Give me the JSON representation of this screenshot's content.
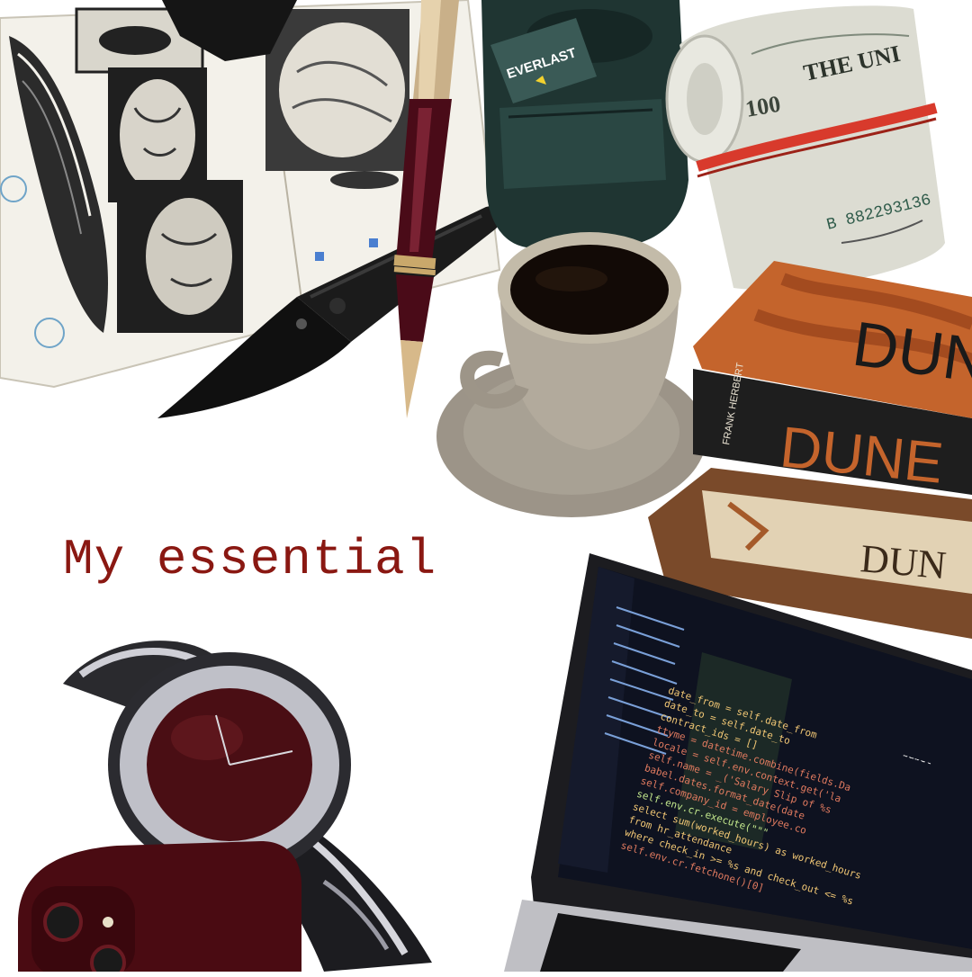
{
  "caption": "My essential",
  "items": {
    "sketchbook": "sketchbook-icon",
    "pen": "fountain-pen-icon",
    "knife": "folding-knife-icon",
    "gloves": "boxing-gloves-icon",
    "money": "cash-roll-icon",
    "coffee": "coffee-cup-icon",
    "books": "books-icon",
    "watch": "watch-icon",
    "phone": "phone-icon",
    "laptop": "laptop-icon"
  },
  "labels": {
    "glove_tag": "EVERLAST",
    "bill_denomination": "100",
    "bill_header": "THE UNI",
    "bill_serial": "B 882293136",
    "book_author": "FRANK HERBERT",
    "book_title_1": "DUNE",
    "book_title_2": "DUNE",
    "book_title_3": "DUN"
  },
  "code": {
    "header": "babel",
    "lines": [
      "date_from = self.date_from",
      "date_to = self.date_to",
      "contract_ids = []",
      "ttyme = datetime.combine(fields.Da",
      "locale = self.env.context.get('la",
      "self.name = _('Salary Slip of %s",
      "babel.dates.format_date(date",
      "self.company_id = employee.co",
      "self.env.cr.execute(\"\"\"",
      "select sum(worked_hours) as worked_hours",
      "from hr_attendance",
      "where check_in >= %s and check_out <= %s",
      "self.env.cr.fetchone()[0]"
    ]
  },
  "colors": {
    "caption": "#8a1812",
    "burgundy": "#5a0f18",
    "coffee": "#120a06",
    "dune_orange": "#c4642c",
    "rubber_band": "#d83a2c",
    "glove_green": "#1f3532",
    "screen_bg": "#0e1220"
  }
}
